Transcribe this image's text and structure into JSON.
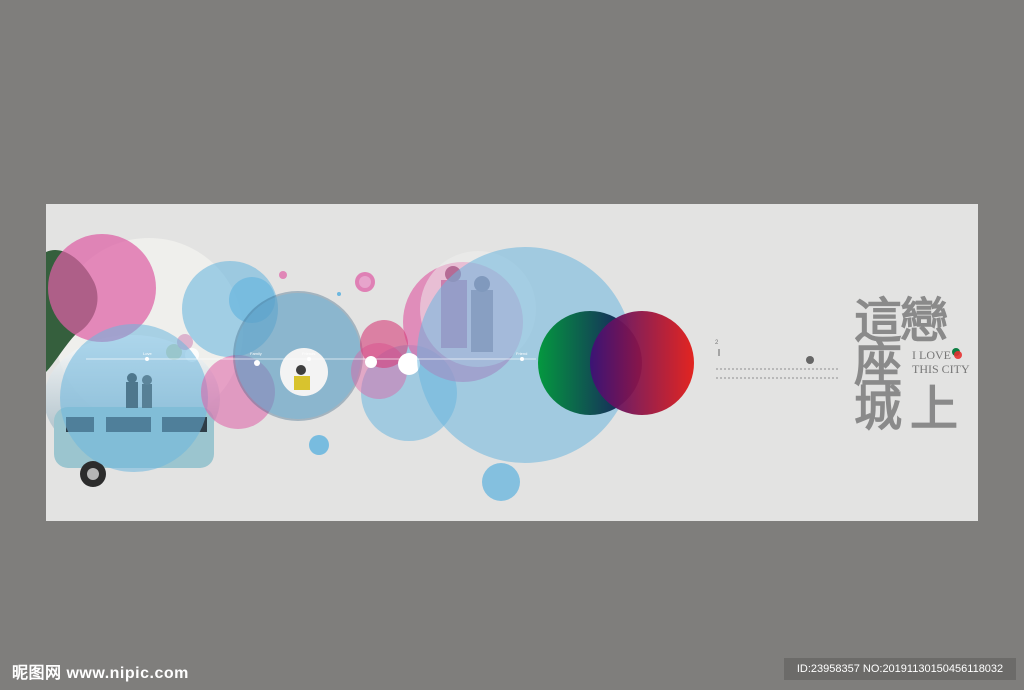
{
  "artwork": {
    "title_chars": [
      "戀",
      "這",
      "座",
      "城",
      "上"
    ],
    "love_lines": [
      "I LOVE",
      "THIS CITY"
    ],
    "side_number": "2",
    "timeline_labels": [
      "Love",
      "Family",
      "Friends",
      "Friend"
    ],
    "colors": {
      "canvas_bg": "#e3e3e2",
      "outer_bg": "#7f7e7c",
      "pink": "#de5fa5",
      "blue": "#6cb7df",
      "green": "#067b3b",
      "red": "#e21c1c"
    }
  },
  "watermark": {
    "brand": "昵图网",
    "site": "www.nipic.com",
    "id_text": "ID:23958357 NO:20191130150456118032"
  }
}
